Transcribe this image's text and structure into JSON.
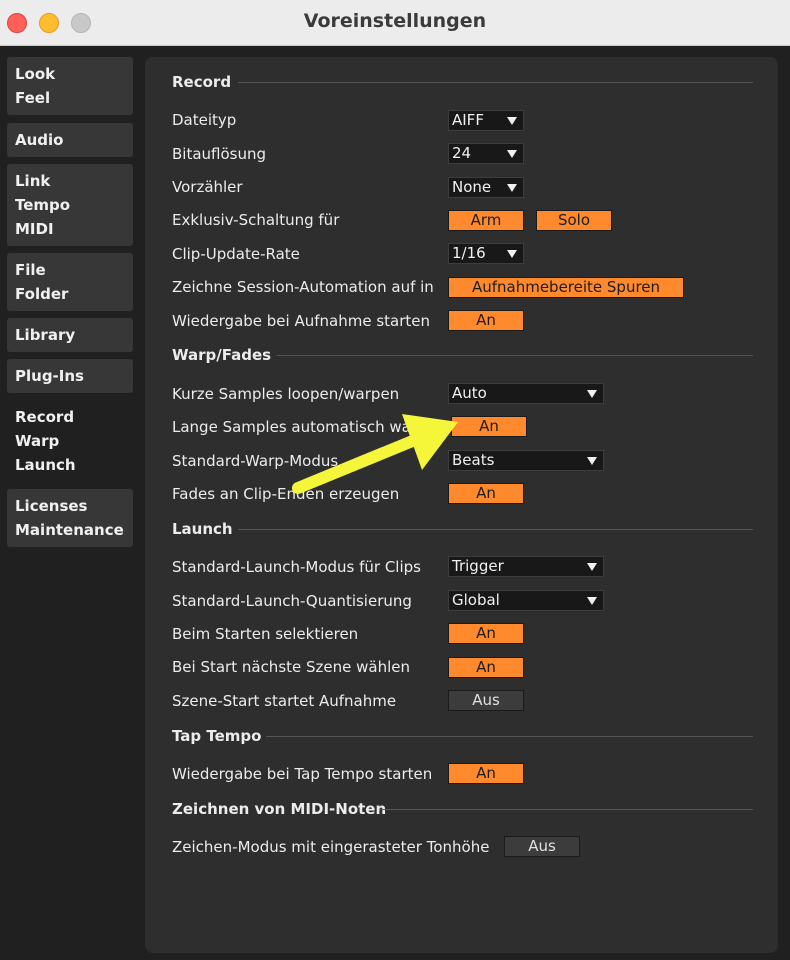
{
  "window": {
    "title": "Voreinstellungen"
  },
  "sidebar": {
    "items": [
      {
        "lines": [
          "Look",
          "Feel"
        ]
      },
      {
        "lines": [
          "Audio"
        ]
      },
      {
        "lines": [
          "Link",
          "Tempo",
          "MIDI"
        ]
      },
      {
        "lines": [
          "File",
          "Folder"
        ]
      },
      {
        "lines": [
          "Library"
        ]
      },
      {
        "lines": [
          "Plug-Ins"
        ]
      },
      {
        "lines": [
          "Record",
          "Warp",
          "Launch"
        ],
        "active": true
      },
      {
        "lines": [
          "Licenses",
          "Maintenance"
        ]
      }
    ]
  },
  "sections": {
    "record": {
      "title": "Record",
      "dateityp": {
        "label": "Dateityp",
        "value": "AIFF"
      },
      "bitaufloesung": {
        "label": "Bitauflösung",
        "value": "24"
      },
      "vorzaehler": {
        "label": "Vorzähler",
        "value": "None"
      },
      "exklusiv": {
        "label": "Exklusiv-Schaltung für",
        "arm": "Arm",
        "solo": "Solo"
      },
      "clip_update": {
        "label": "Clip-Update-Rate",
        "value": "1/16"
      },
      "session_automation": {
        "label": "Zeichne Session-Automation auf in",
        "value": "Aufnahmebereite Spuren"
      },
      "wiedergabe_aufnahme": {
        "label": "Wiedergabe bei Aufnahme starten",
        "value": "An"
      }
    },
    "warp": {
      "title": "Warp/Fades",
      "kurze_samples": {
        "label": "Kurze Samples loopen/warpen",
        "value": "Auto"
      },
      "lange_samples": {
        "label": "Lange Samples automatisch warpen",
        "value": "An"
      },
      "warp_modus": {
        "label": "Standard-Warp-Modus",
        "value": "Beats"
      },
      "fades": {
        "label": "Fades an Clip-Enden erzeugen",
        "value": "An"
      }
    },
    "launch": {
      "title": "Launch",
      "launch_modus": {
        "label": "Standard-Launch-Modus für Clips",
        "value": "Trigger"
      },
      "quantisierung": {
        "label": "Standard-Launch-Quantisierung",
        "value": "Global"
      },
      "beim_starten": {
        "label": "Beim Starten selektieren",
        "value": "An"
      },
      "naechste_szene": {
        "label": "Bei Start nächste Szene wählen",
        "value": "An"
      },
      "szene_start": {
        "label": "Szene-Start startet Aufnahme",
        "value": "Aus"
      }
    },
    "tap_tempo": {
      "title": "Tap Tempo",
      "wiedergabe_tap": {
        "label": "Wiedergabe bei Tap Tempo starten",
        "value": "An"
      }
    },
    "midi_noten": {
      "title": "Zeichnen von MIDI-Noten",
      "zeichen_modus": {
        "label": "Zeichen-Modus mit eingerasteter Tonhöhe",
        "value": "Aus"
      }
    }
  },
  "colors": {
    "accent_on": "#ff8a2e",
    "annotation_arrow": "#f5f53a",
    "panel_bg": "#2e2e2e"
  }
}
